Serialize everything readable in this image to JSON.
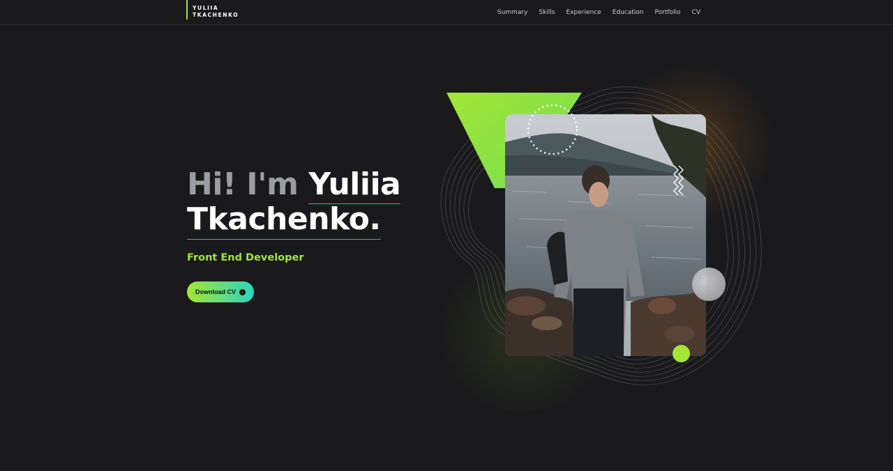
{
  "brand": {
    "line1": "YULIIA",
    "line2": "TKACHENKO",
    "accent": "#a3e635"
  },
  "nav": {
    "items": [
      {
        "label": "Summary"
      },
      {
        "label": "Skills"
      },
      {
        "label": "Experience"
      },
      {
        "label": "Education"
      },
      {
        "label": "Portfolio"
      },
      {
        "label": "CV"
      }
    ]
  },
  "hero": {
    "greeting": "Hi! I'm ",
    "first_name": "Yuliia",
    "last_name": "Tkachenko.",
    "role": "Front End Developer",
    "cta_label": "Download CV",
    "cta_icon": "arrow-down-circle-icon"
  },
  "colors": {
    "background": "#1a1a1c",
    "lime": "#a3e635",
    "teal": "#2dd4bf",
    "underline": "#22c55e",
    "greeting_gray": "#9c9ca3"
  }
}
